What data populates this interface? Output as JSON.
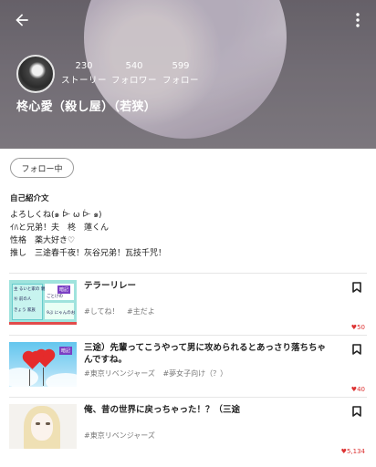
{
  "header": {
    "back_icon": "arrow-left-icon",
    "more_icon": "vertical-dots-icon"
  },
  "profile": {
    "name": "柊心愛（殺し屋）（若狭）",
    "stats": [
      {
        "value": "230",
        "label": "ストーリー"
      },
      {
        "value": "540",
        "label": "フォロワー"
      },
      {
        "value": "599",
        "label": "フォロー"
      }
    ],
    "follow_button": "フォロー中",
    "bio_title": "自己紹介文",
    "bio_lines": [
      "よろしくね(๑ ᐕ ω ᐕ ๑)",
      "ｲﾊと兄弟！夫　柊　蓮くん",
      "性格　薬大好き♡",
      "推し　三途春千夜！灰谷兄弟！瓦技千咒！"
    ]
  },
  "stories": [
    {
      "title": "テラーリレー",
      "tags": [
        "#してね！",
        "#主だよ"
      ],
      "likes": "50",
      "thumb_badge": "暗記",
      "thumb_texts": [
        "主 るいと家の 親",
        "Ⓝ 前の人",
        "ごとけの",
        "きょう 家族",
        "9ぶ にゃんのお"
      ]
    },
    {
      "title": "三途）先輩ってこうやって男に攻められるとあっさり落ちちゃんですね。",
      "tags": [
        "#東京リベンジャーズ",
        "#夢女子向け（？）"
      ],
      "likes": "40",
      "thumb_badge": "暗記"
    },
    {
      "title": "俺、昔の世界に戻っちゃった！？（三途",
      "tags": [
        "#東京リベンジャーズ"
      ],
      "likes": "5,134"
    }
  ],
  "colors": {
    "like_red": "#dd3333",
    "divider": "#e6e6e6",
    "header_gray": "#7d7880"
  },
  "icons": {
    "bookmark": "bookmark-icon",
    "heart": "heart-icon"
  }
}
